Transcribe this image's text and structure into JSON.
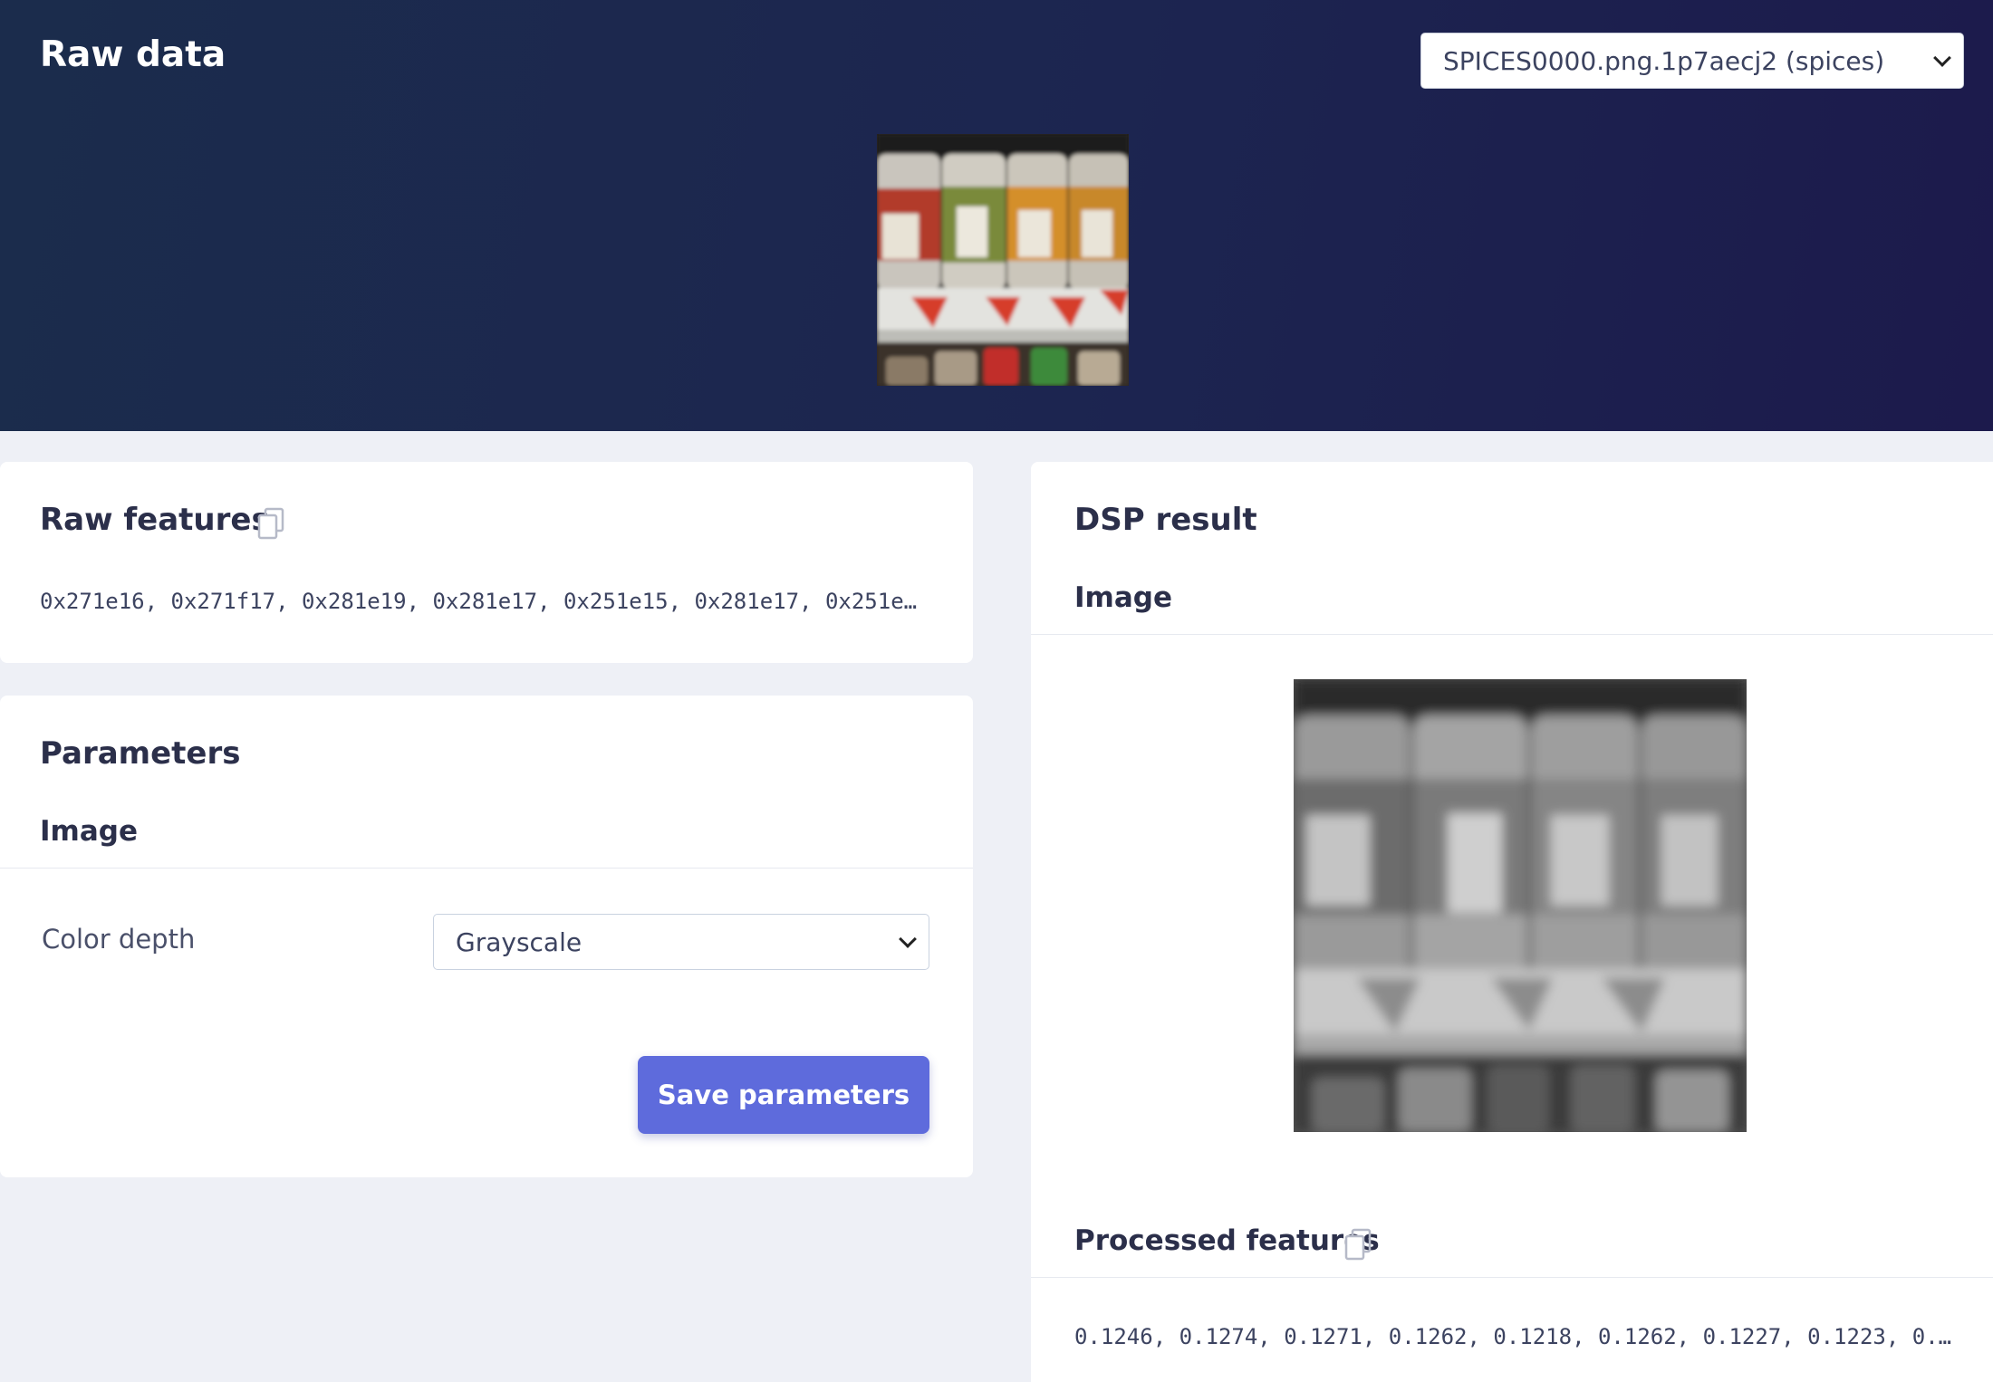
{
  "header": {
    "title": "Raw data",
    "sample_select": {
      "value": "SPICES0000.png.1p7aecj2 (spices)"
    },
    "thumbnail": "raw-image-spices-shelf"
  },
  "raw_features": {
    "title": "Raw features",
    "copy_icon": "copy-icon",
    "values": "0x271e16, 0x271f17, 0x281e19, 0x281e17, 0x251e15, 0x281e17, 0x251e…"
  },
  "parameters": {
    "title": "Parameters",
    "section_title": "Image",
    "color_depth": {
      "label": "Color depth",
      "value": "Grayscale"
    },
    "save_label": "Save parameters"
  },
  "dsp_result": {
    "title": "DSP result",
    "section_title": "Image",
    "processed_features": {
      "title": "Processed features",
      "copy_icon": "copy-icon",
      "values": "0.1246, 0.1274, 0.1271, 0.1262, 0.1218, 0.1262, 0.1227, 0.1223, 0.…"
    }
  },
  "colors": {
    "header_bg": "#1c2550",
    "accent": "#5e6bdc",
    "page_bg": "#eef0f6"
  }
}
